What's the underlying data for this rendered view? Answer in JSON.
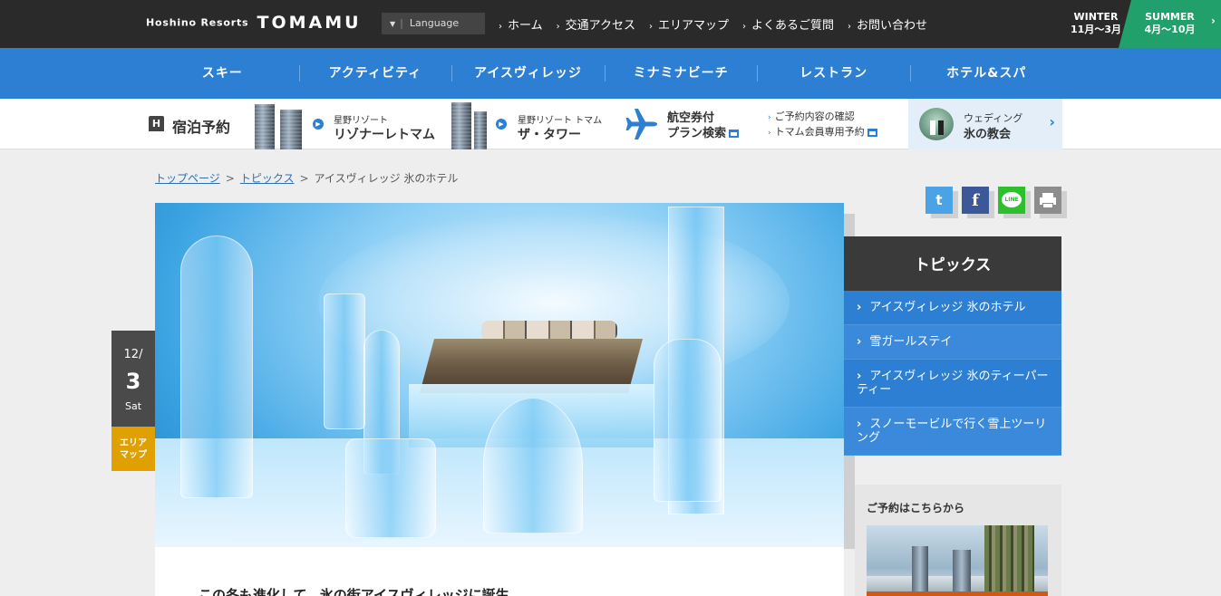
{
  "brand": {
    "small": "Hoshino Resorts",
    "big": "TOMAMU"
  },
  "lang": {
    "caret": "▼",
    "label": "Language"
  },
  "topnav": [
    {
      "label": "ホーム"
    },
    {
      "label": "交通アクセス"
    },
    {
      "label": "エリアマップ"
    },
    {
      "label": "よくあるご質問"
    },
    {
      "label": "お問い合わせ"
    }
  ],
  "seasons": {
    "winter": {
      "name": "WINTER",
      "months": "11月〜3月"
    },
    "summer": {
      "name": "SUMMER",
      "months": "4月〜10月"
    }
  },
  "mainnav": [
    {
      "label": "スキー"
    },
    {
      "label": "アクティビティ"
    },
    {
      "label": "アイスヴィレッジ"
    },
    {
      "label": "ミナミナビーチ"
    },
    {
      "label": "レストラン"
    },
    {
      "label": "ホテル&スパ"
    }
  ],
  "booking": {
    "h_icon": "H",
    "label": "宿泊予約",
    "hotel1": {
      "small": "星野リゾート",
      "big": "リゾナーレトマム"
    },
    "hotel2": {
      "small": "星野リゾート トマム",
      "big": "ザ・タワー"
    },
    "air": {
      "line1": "航空券付",
      "line2": "プラン検索"
    },
    "links": [
      {
        "label": "ご予約内容の確認"
      },
      {
        "label": "トマム会員専用予約"
      }
    ],
    "wedding": {
      "small": "ウェディング",
      "big": "氷の教会"
    }
  },
  "breadcrumb": {
    "home": "トップページ",
    "topics": "トピックス",
    "current": "アイスヴィレッジ 氷のホテル",
    "sep": ">"
  },
  "share": {
    "twitter": "t",
    "facebook": "f",
    "line": "LINE"
  },
  "date": {
    "md": "12/",
    "day": "3",
    "weekday": "Sat"
  },
  "area_map": {
    "line1": "エリア",
    "line2": "マップ"
  },
  "article": {
    "title": "この冬も進化して、氷の街アイスヴィレッジに誕生"
  },
  "sidebar": {
    "topics_title": "トピックス",
    "topics": [
      {
        "label": "アイスヴィレッジ 氷のホテル"
      },
      {
        "label": "雪ガールステイ"
      },
      {
        "label": "アイスヴィレッジ 氷のティーパーティー"
      },
      {
        "label": "スノーモービルで行く雪上ツーリング"
      }
    ],
    "reserve_title": "ご予約はこちらから"
  },
  "colors": {
    "topbar": "#2a2a2a",
    "nav_blue": "#2d7fd3",
    "summer_green": "#22a06b",
    "area_orange": "#e0a100"
  },
  "icons": {
    "arrow": "›",
    "chevron": ">"
  }
}
